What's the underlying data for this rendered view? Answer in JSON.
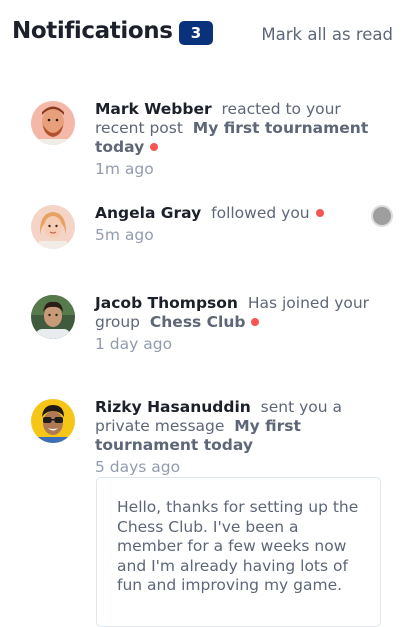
{
  "header": {
    "title": "Notifications",
    "unread_count": "3",
    "mark_all_label": "Mark all as read"
  },
  "notifications": [
    {
      "name": "Mark Webber",
      "action": "reacted to your recent post",
      "target": "My first tournament today",
      "time": "1m ago",
      "unread": true,
      "avatar_icon": "avatar-mark-webber"
    },
    {
      "name": "Angela Gray",
      "action": "followed you",
      "target": "",
      "time": "5m ago",
      "unread": true,
      "avatar_icon": "avatar-angela-gray"
    },
    {
      "name": "Jacob Thompson",
      "action": "Has joined your group",
      "target": "Chess Club",
      "time": "1 day ago",
      "unread": true,
      "avatar_icon": "avatar-jacob-thompson"
    },
    {
      "name": "Rizky Hasanuddin",
      "action": "sent you a private message",
      "target": "My first tournament today",
      "time": "5 days ago",
      "unread": false,
      "avatar_icon": "avatar-rizky-hasanuddin",
      "message": "Hello, thanks for setting up the Chess Club. I've been a member for a few weeks now and I'm already having lots of fun and improving my game."
    }
  ],
  "colors": {
    "badge": "#0a327b",
    "unread_dot": "#f65552",
    "name": "#1c202b",
    "body_text": "#5e6778",
    "time_text": "#939cad"
  }
}
